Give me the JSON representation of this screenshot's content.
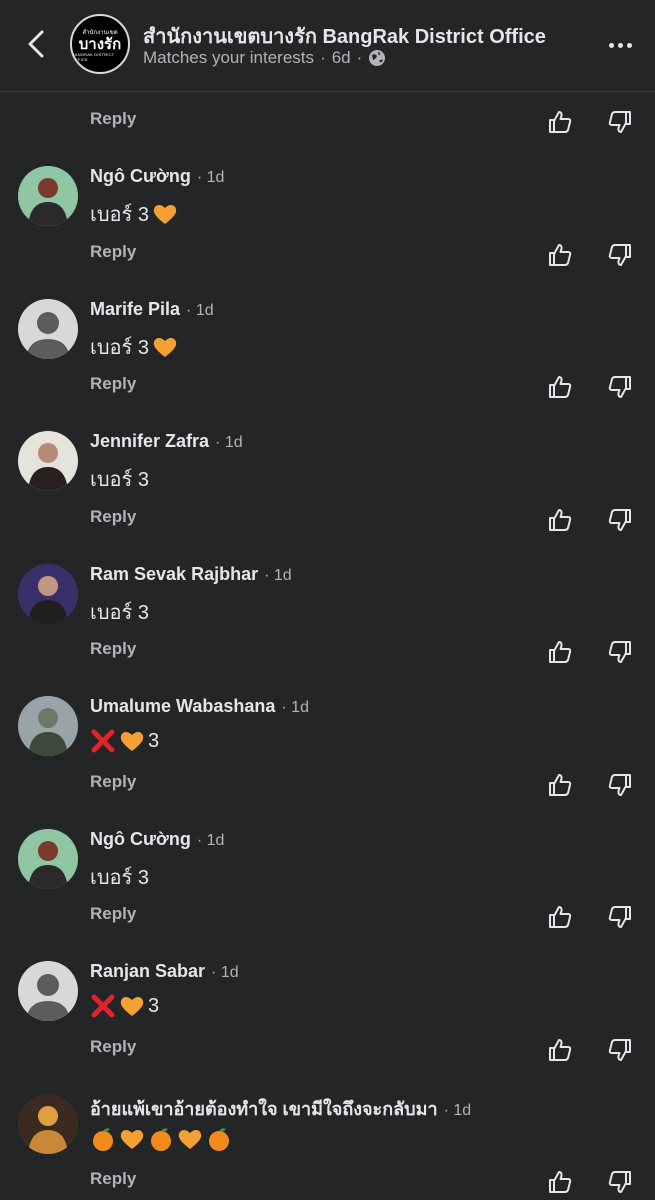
{
  "header": {
    "title": "สำนักงานเขตบางรัก BangRak District Office",
    "subtitle": "Matches your interests",
    "age": "6d",
    "avatar_line1": "สำนักงานเขต",
    "avatar_line2": "บางรัก",
    "avatar_line3": "BANGRAK DISTRICT OFFICE"
  },
  "reply_label": "Reply",
  "comments": [
    {
      "name": "Ngô Cường",
      "time": "1d",
      "text": "เบอร์ 3",
      "emojis": [
        "orange-heart"
      ]
    },
    {
      "name": "Marife Pila",
      "time": "1d",
      "text": "เบอร์ 3",
      "emojis": [
        "orange-heart"
      ]
    },
    {
      "name": "Jennifer Zafra",
      "time": "1d",
      "text": "เบอร์ 3",
      "emojis": []
    },
    {
      "name": "Ram Sevak Rajbhar",
      "time": "1d",
      "text": "เบอร์ 3",
      "emojis": []
    },
    {
      "name": "Umalume Wabashana",
      "time": "1d",
      "text": "3",
      "emojis": [
        "cross-mark",
        "orange-heart"
      ]
    },
    {
      "name": "Ngô Cường",
      "time": "1d",
      "text": "เบอร์ 3",
      "emojis": []
    },
    {
      "name": "Ranjan Sabar",
      "time": "1d",
      "text": "3",
      "emojis": [
        "cross-mark",
        "orange-heart"
      ]
    },
    {
      "name": "อ้ายแพ้เขาอ้ายต้องทำใจ เขามีใจถึงจะกลับมา",
      "time": "1d",
      "text": "",
      "emojis": [
        "tangerine",
        "orange-heart",
        "tangerine",
        "orange-heart",
        "tangerine"
      ]
    }
  ],
  "colors": {
    "background": "#242526",
    "text": "#e4e6eb",
    "secondary": "#b0b3b8",
    "orange_heart": "#f5a033",
    "cross": "#e0242c"
  }
}
